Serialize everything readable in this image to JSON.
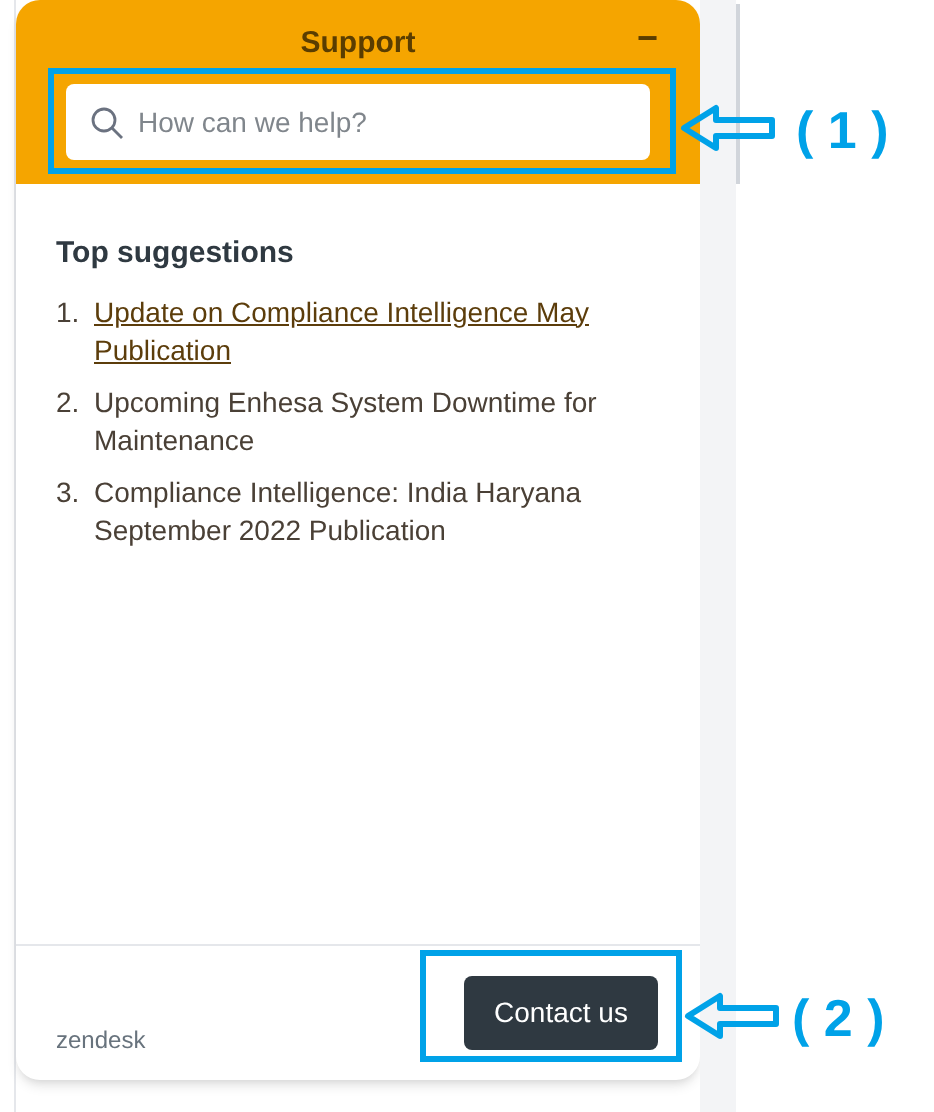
{
  "widget": {
    "title": "Support",
    "minimize": "−",
    "search": {
      "placeholder": "How can we help?"
    },
    "suggestions_title": "Top suggestions",
    "suggestions": [
      {
        "number": "1.",
        "text": "Update on Compliance Intelligence May Publication",
        "kind": "link"
      },
      {
        "number": "2.",
        "text": "Upcoming Enhesa System Downtime for Maintenance",
        "kind": "plain"
      },
      {
        "number": "3.",
        "text": "Compliance Intelligence: India Haryana September 2022 Publication",
        "kind": "plain"
      }
    ],
    "footer": {
      "brand": "zendesk",
      "button": "Contact us"
    }
  },
  "annotations": [
    {
      "label": "( 1 )"
    },
    {
      "label": "( 2 )"
    }
  ]
}
